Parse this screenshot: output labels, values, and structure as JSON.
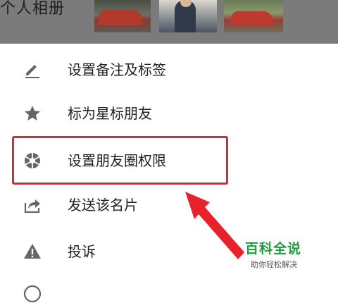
{
  "header": {
    "album_label": "个人相册"
  },
  "menu": {
    "items": [
      {
        "label": "设置备注及标签",
        "icon": "pencil-icon"
      },
      {
        "label": "标为星标朋友",
        "icon": "star-icon"
      },
      {
        "label": "设置朋友圈权限",
        "icon": "aperture-icon"
      },
      {
        "label": "发送该名片",
        "icon": "share-icon"
      },
      {
        "label": "投诉",
        "icon": "warning-icon"
      }
    ]
  },
  "annotation": {
    "highlight_color": "#e8222a"
  },
  "watermark": {
    "title": "百科全说",
    "subtitle": "助你轻松解决",
    "color": "#1f9d3a"
  }
}
